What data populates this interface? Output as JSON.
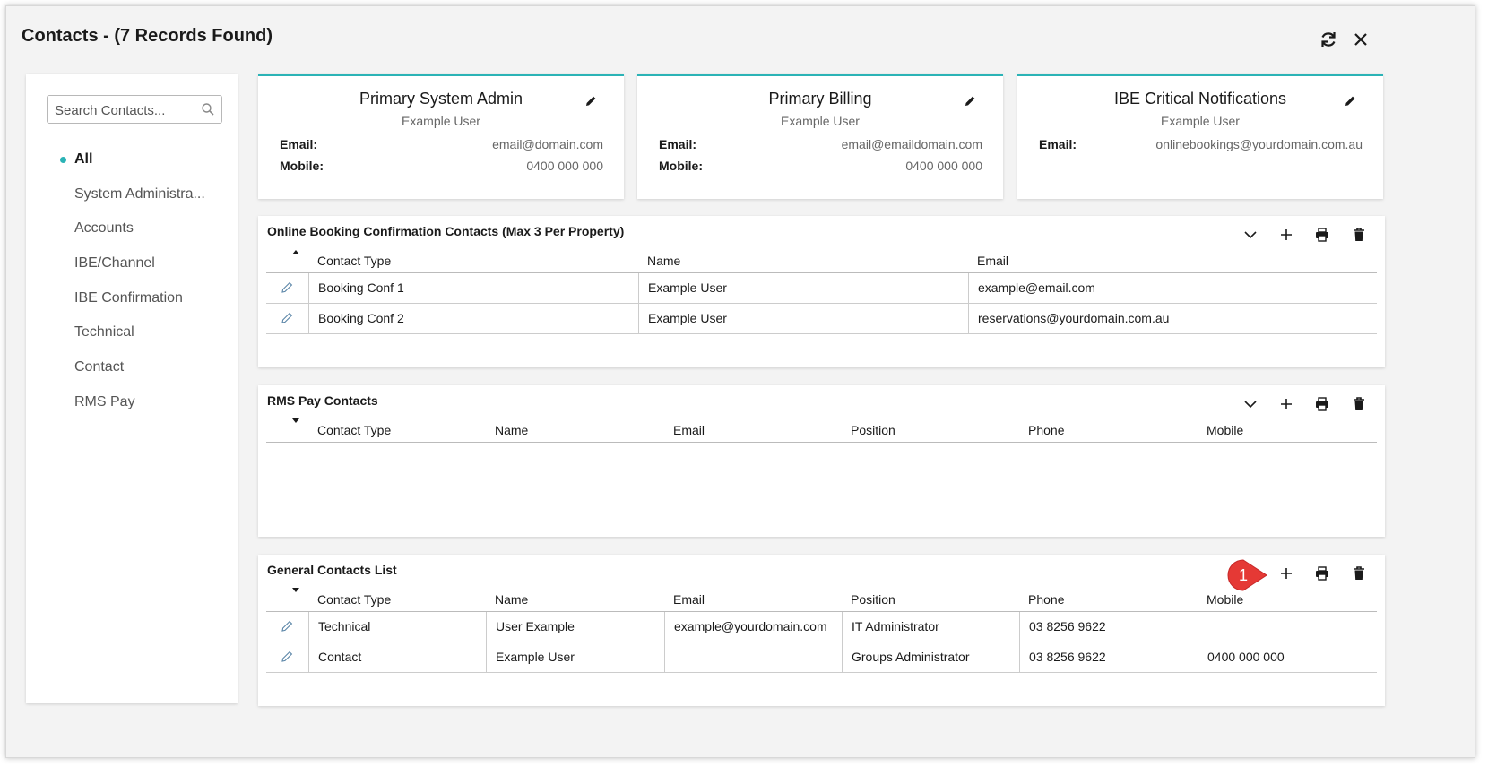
{
  "dialog": {
    "title": "Contacts - (7 Records Found)",
    "refresh_icon": "refresh-icon",
    "close_icon": "close-icon"
  },
  "sidebar": {
    "search": {
      "placeholder": "Search Contacts...",
      "value": ""
    },
    "items": [
      {
        "label": "All",
        "active": true
      },
      {
        "label": "System Administra..."
      },
      {
        "label": "Accounts"
      },
      {
        "label": "IBE/Channel"
      },
      {
        "label": "IBE Confirmation"
      },
      {
        "label": "Technical"
      },
      {
        "label": "Contact"
      },
      {
        "label": "RMS Pay"
      }
    ]
  },
  "cards": [
    {
      "title": "Primary System Admin",
      "name": "Example User",
      "email_label": "Email:",
      "email": "email@domain.com",
      "mobile_label": "Mobile:",
      "mobile": "0400 000 000"
    },
    {
      "title": "Primary Billing",
      "name": "Example User",
      "email_label": "Email:",
      "email": "email@emaildomain.com",
      "mobile_label": "Mobile:",
      "mobile": "0400 000 000"
    },
    {
      "title": "IBE Critical Notifications",
      "name": "Example User",
      "email_label": "Email:",
      "email": "onlinebookings@yourdomain.com.au"
    }
  ],
  "online_booking": {
    "title": "Online Booking Confirmation Contacts (Max 3 Per Property)",
    "columns": [
      "Contact Type",
      "Name",
      "Email"
    ],
    "rows": [
      [
        "Booking Conf 1",
        "Example User",
        "example@email.com"
      ],
      [
        "Booking Conf 2",
        "Example User",
        "reservations@yourdomain.com.au"
      ]
    ]
  },
  "rms_pay": {
    "title": "RMS Pay Contacts",
    "columns": [
      "Contact Type",
      "Name",
      "Email",
      "Position",
      "Phone",
      "Mobile"
    ],
    "rows": []
  },
  "general": {
    "title": "General Contacts List",
    "columns": [
      "Contact Type",
      "Name",
      "Email",
      "Position",
      "Phone",
      "Mobile"
    ],
    "rows": [
      [
        "Technical",
        "User Example",
        "example@yourdomain.com",
        "IT Administrator",
        "03 8256 9622",
        ""
      ],
      [
        "Contact",
        "Example User",
        "",
        "Groups Administrator",
        "03 8256 9622",
        "0400 000 000"
      ]
    ]
  },
  "callout": {
    "number": "1",
    "color": "#e53935"
  },
  "colors": {
    "accent": "#2bb3b6",
    "background": "#f3f3f3"
  }
}
